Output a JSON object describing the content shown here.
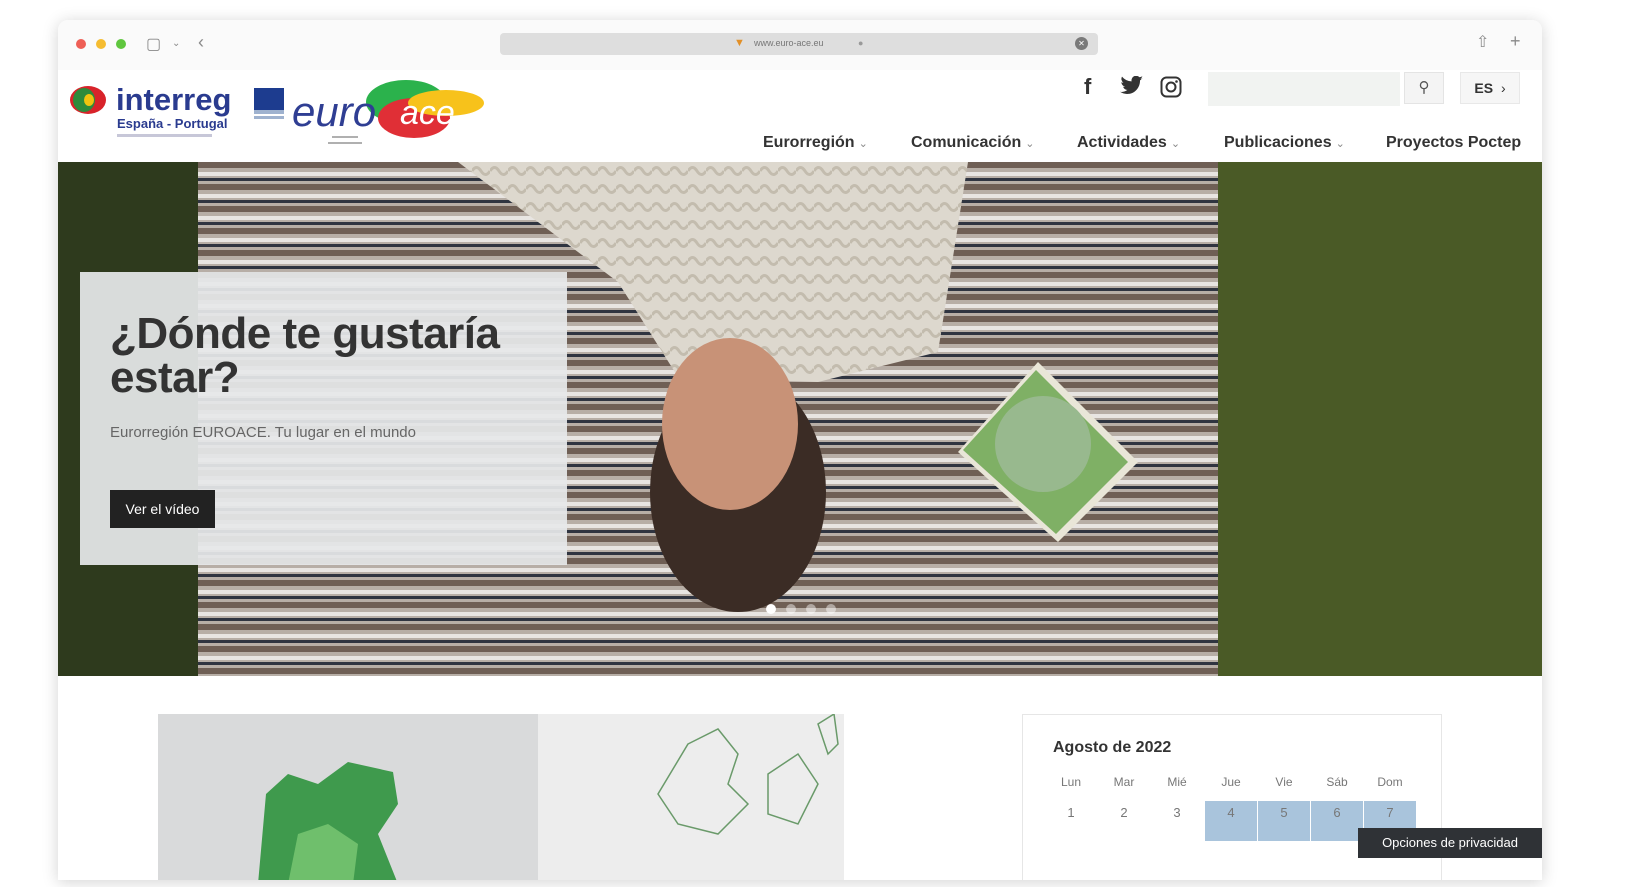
{
  "browser": {
    "url": "www.euro-ace.eu"
  },
  "header": {
    "logo": {
      "brand": "interreg",
      "subtitle": "España - Portugal",
      "partner": "euroace"
    },
    "social_icons": [
      "facebook-icon",
      "twitter-icon",
      "instagram-icon"
    ],
    "search_placeholder": "",
    "language": "ES",
    "nav": [
      {
        "label": "Eurorregión",
        "has_dropdown": true
      },
      {
        "label": "Comunicación",
        "has_dropdown": true
      },
      {
        "label": "Actividades",
        "has_dropdown": true
      },
      {
        "label": "Publicaciones",
        "has_dropdown": true
      },
      {
        "label": "Proyectos Poctep",
        "has_dropdown": false
      }
    ]
  },
  "hero": {
    "title": "¿Dónde te gustaría estar?",
    "subtitle": "Eurorregión EUROACE. Tu lugar en el mundo",
    "button": "Ver el vídeo",
    "slides_count": 4,
    "active_slide": 1
  },
  "calendar": {
    "title": "Agosto de 2022",
    "weekdays": [
      "Lun",
      "Mar",
      "Mié",
      "Jue",
      "Vie",
      "Sáb",
      "Dom"
    ],
    "first_row": [
      "1",
      "2",
      "3",
      "4",
      "5",
      "6",
      "7"
    ],
    "highlighted": [
      "4",
      "5",
      "6",
      "7"
    ]
  },
  "privacy_button": "Opciones de privacidad",
  "colors": {
    "hero_card": "#e6e8ea",
    "button_dark": "#222222",
    "calendar_highlight": "#a9c4dc",
    "privacy_bg": "#2f3236"
  }
}
